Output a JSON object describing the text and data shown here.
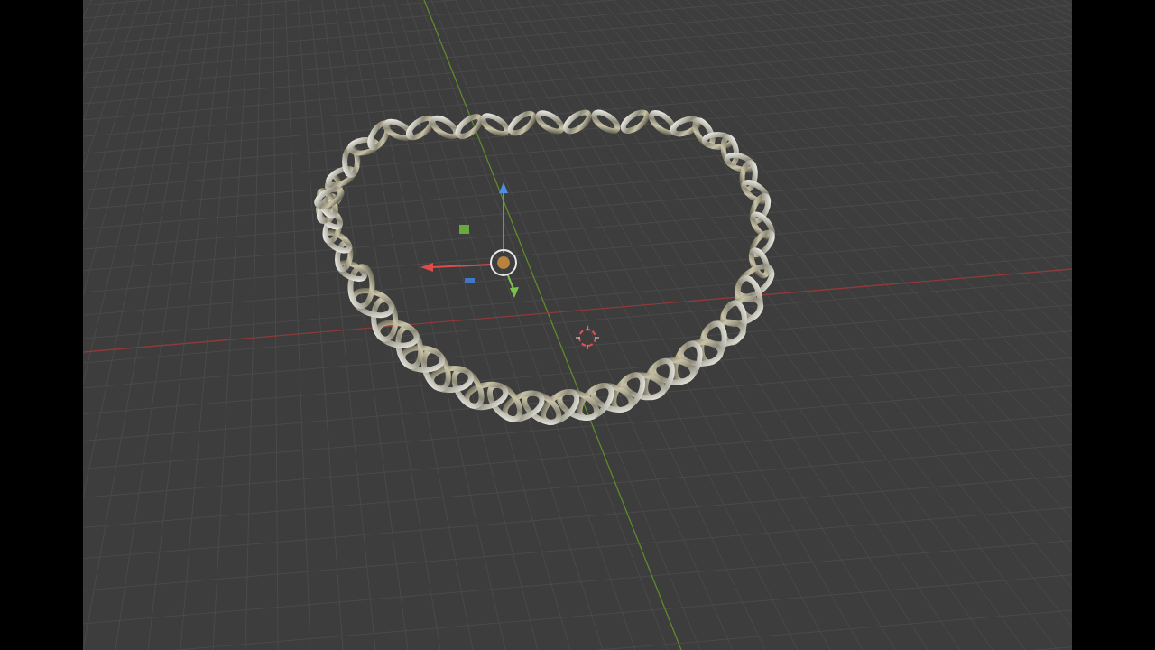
{
  "viewport": {
    "grid": true,
    "gizmo": true,
    "cursor_3d": true
  }
}
